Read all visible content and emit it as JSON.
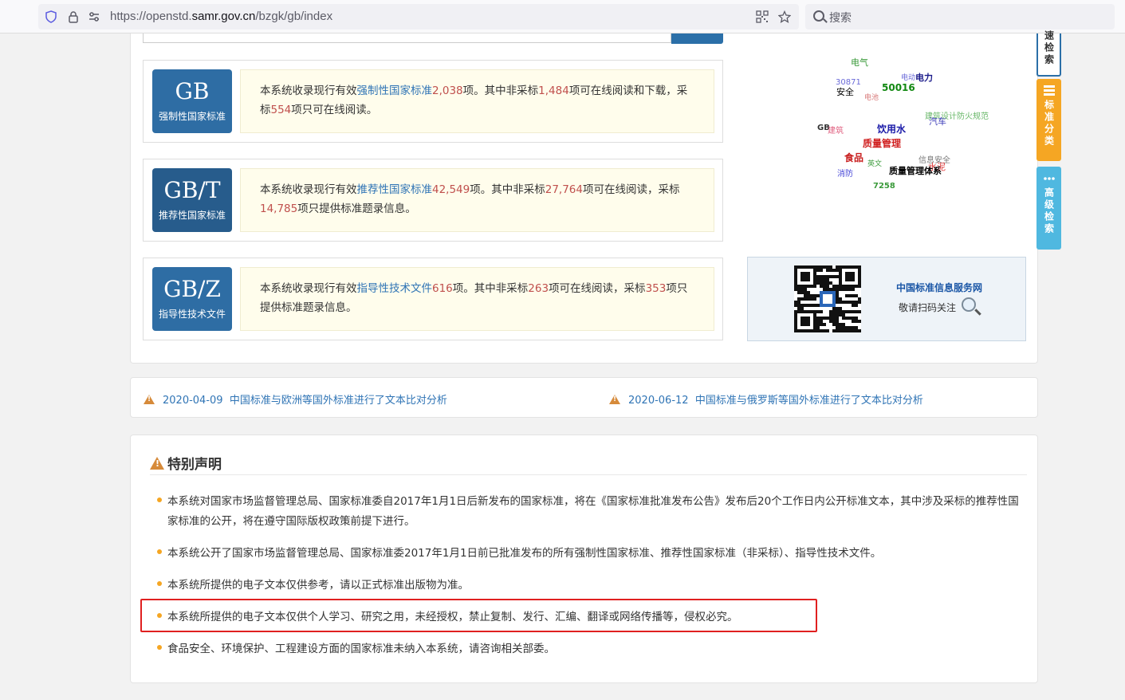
{
  "browser": {
    "url_prefix": "https://openstd.",
    "url_domain": "samr.gov.cn",
    "url_path": "/bzgk/gb/index",
    "search_placeholder": "搜索"
  },
  "standards": [
    {
      "code": "GB",
      "name": "强制性国家标准",
      "color": "#2e6da4",
      "d1": "本系统收录现行有效",
      "link": "强制性国家标准",
      "n1": "2,038",
      "d2": "项。其中非采标",
      "n2": "1,484",
      "d3": "项可在线阅读和下载，采标",
      "n3": "554",
      "d4": "项只可在线阅读。"
    },
    {
      "code": "GB/T",
      "name": "推荐性国家标准",
      "color": "#275c8c",
      "d1": "本系统收录现行有效",
      "link": "推荐性国家标准",
      "n1": "42,549",
      "d2": "项。其中非采标",
      "n2": "27,764",
      "d3": "项可在线阅读，采标",
      "n3": "14,785",
      "d4": "项只提供标准题录信息。"
    },
    {
      "code": "GB/Z",
      "name": "指导性技术文件",
      "color": "#2e6da4",
      "d1": "本系统收录现行有效",
      "link": "指导性技术文件",
      "n1": "616",
      "d2": "项。其中非采标",
      "n2": "263",
      "d3": "项可在线阅读，采标",
      "n3": "353",
      "d4": "项只提供标准题录信息。"
    }
  ],
  "tags": [
    "电气",
    "30871",
    "电动",
    "电力",
    "安全",
    "50016",
    "电池",
    "建筑设计防火规范",
    "汽车",
    "GB",
    "建筑",
    "饮用水",
    "质量管理",
    "食品",
    "信息安全",
    "消防",
    "英文",
    "水泥",
    "质量管理体系",
    "7258"
  ],
  "qr": {
    "title": "中国标准信息服务网",
    "subtitle": "敬请扫码关注"
  },
  "side_tabs": {
    "fast": "速检索",
    "classify": "标准分类",
    "advanced": "高级检索"
  },
  "news": [
    {
      "date": "2020-04-09",
      "title": "中国标准与欧洲等国外标准进行了文本比对分析"
    },
    {
      "date": "2020-06-12",
      "title": "中国标准与俄罗斯等国外标准进行了文本比对分析"
    }
  ],
  "statement": {
    "title": "特别声明",
    "items": [
      "本系统对国家市场监督管理总局、国家标准委自2017年1月1日后新发布的国家标准，将在《国家标准批准发布公告》发布后20个工作日内公开标准文本，其中涉及采标的推荐性国家标准的公开，将在遵守国际版权政策前提下进行。",
      "本系统公开了国家市场监督管理总局、国家标准委2017年1月1日前已批准发布的所有强制性国家标准、推荐性国家标准（非采标）、指导性技术文件。",
      "本系统所提供的电子文本仅供参考，请以正式标准出版物为准。",
      "本系统所提供的电子文本仅供个人学习、研究之用，未经授权，禁止复制、发行、汇编、翻译或网络传播等，侵权必究。",
      "食品安全、环境保护、工程建设方面的国家标准未纳入本系统，请咨询相关部委。"
    ]
  }
}
